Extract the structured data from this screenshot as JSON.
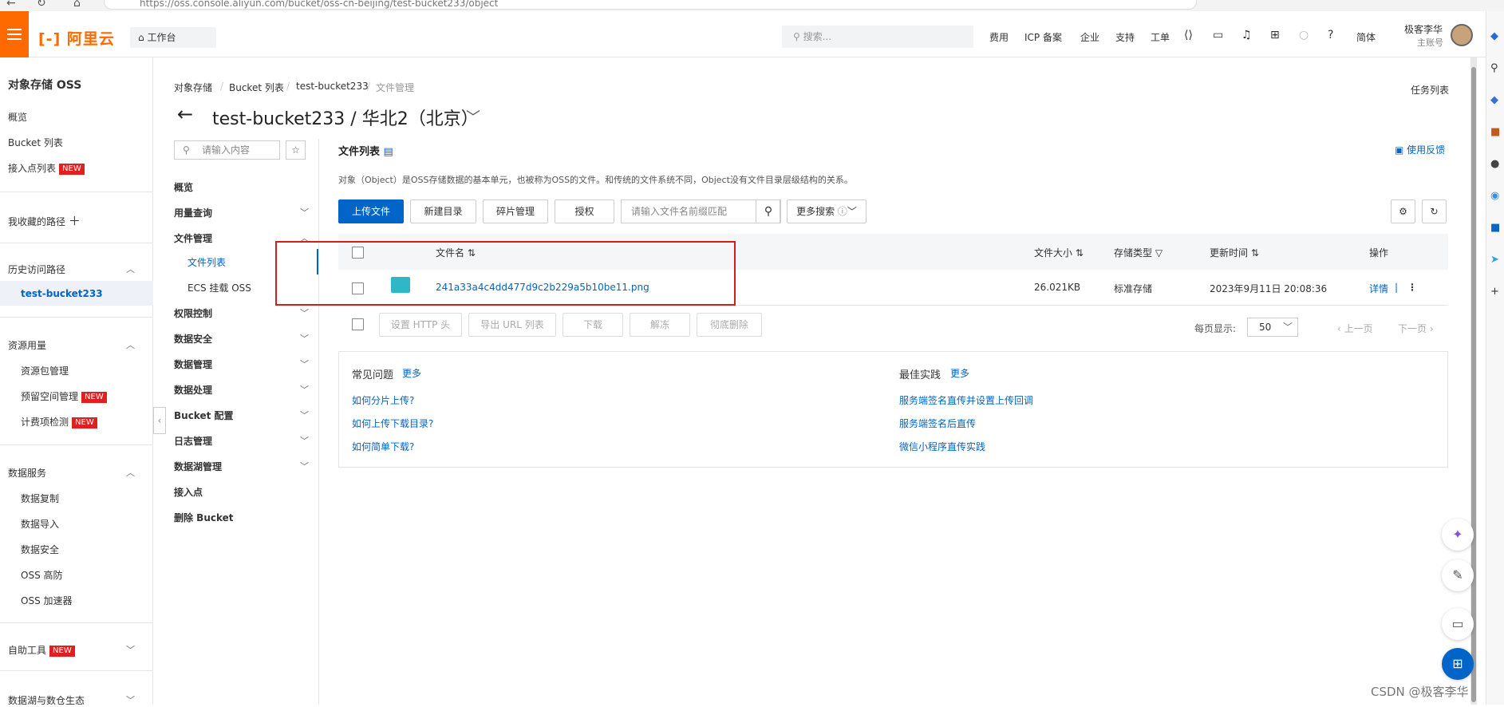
{
  "browser": {
    "url": "https://oss.console.aliyun.com/bucket/oss-cn-beijing/test-bucket233/object"
  },
  "topnav": {
    "logo": "阿里云",
    "workbench": "工作台",
    "search_placeholder": "搜索...",
    "links": [
      "费用",
      "ICP 备案",
      "企业",
      "支持",
      "工单"
    ],
    "lang": "简体",
    "user_name": "极客李华",
    "user_role": "主账号"
  },
  "sidebar": {
    "title": "对象存储 OSS",
    "items": [
      "概览",
      "Bucket 列表",
      "接入点列表"
    ],
    "new_badge": "NEW",
    "favorites": "我收藏的路径",
    "history": "历史访问路径",
    "history_item": "test-bucket233",
    "resource": "资源用量",
    "resource_items": [
      "资源包管理",
      "预留空间管理",
      "计费项检测"
    ],
    "data_service": "数据服务",
    "data_items": [
      "数据复制",
      "数据导入",
      "数据安全",
      "OSS 高防",
      "OSS 加速器"
    ],
    "tools": "自助工具",
    "lake": "数据湖与数仓生态"
  },
  "breadcrumb": [
    "对象存储",
    "Bucket 列表",
    "test-bucket233",
    "文件管理"
  ],
  "page": {
    "title": "test-bucket233 / 华北2（北京）",
    "task_list": "任务列表"
  },
  "subnav": {
    "search_placeholder": "请输入内容",
    "items": [
      "概览",
      "用量查询",
      "文件管理",
      "权限控制",
      "数据安全",
      "数据管理",
      "数据处理",
      "Bucket 配置",
      "日志管理",
      "数据湖管理",
      "接入点",
      "删除 Bucket"
    ],
    "file_sub": [
      "文件列表",
      "ECS 挂载 OSS"
    ]
  },
  "main": {
    "list_title": "文件列表",
    "feedback": "使用反馈",
    "description": "对象（Object）是OSS存储数据的基本单元，也被称为OSS的文件。和传统的文件系统不同，Object没有文件目录层级结构的关系。",
    "buttons": [
      "上传文件",
      "新建目录",
      "碎片管理",
      "授权"
    ],
    "search_placeholder": "请输入文件名前缀匹配",
    "more_search": "更多搜索",
    "columns": [
      "文件名",
      "文件大小",
      "存储类型",
      "更新时间",
      "操作"
    ],
    "row": {
      "name": "241a33a4c4dd477d9c2b229a5b10be11.png",
      "size": "26.021KB",
      "storage": "标准存储",
      "updated": "2023年9月11日 20:08:36",
      "detail": "详情",
      "sep": "|"
    },
    "bulk_buttons": [
      "设置 HTTP 头",
      "导出 URL 列表",
      "下载",
      "解冻",
      "彻底删除"
    ],
    "per_page_label": "每页显示:",
    "per_page": "50",
    "prev": "上一页",
    "next": "下一页"
  },
  "faq": {
    "left_title": "常见问题",
    "right_title": "最佳实践",
    "more": "更多",
    "left_links": [
      "如何分片上传?",
      "如何上传下载目录?",
      "如何简单下载?"
    ],
    "right_links": [
      "服务端签名直传并设置上传回调",
      "服务端签名后直传",
      "微信小程序直传实践"
    ]
  },
  "watermark": "CSDN @极客李华"
}
